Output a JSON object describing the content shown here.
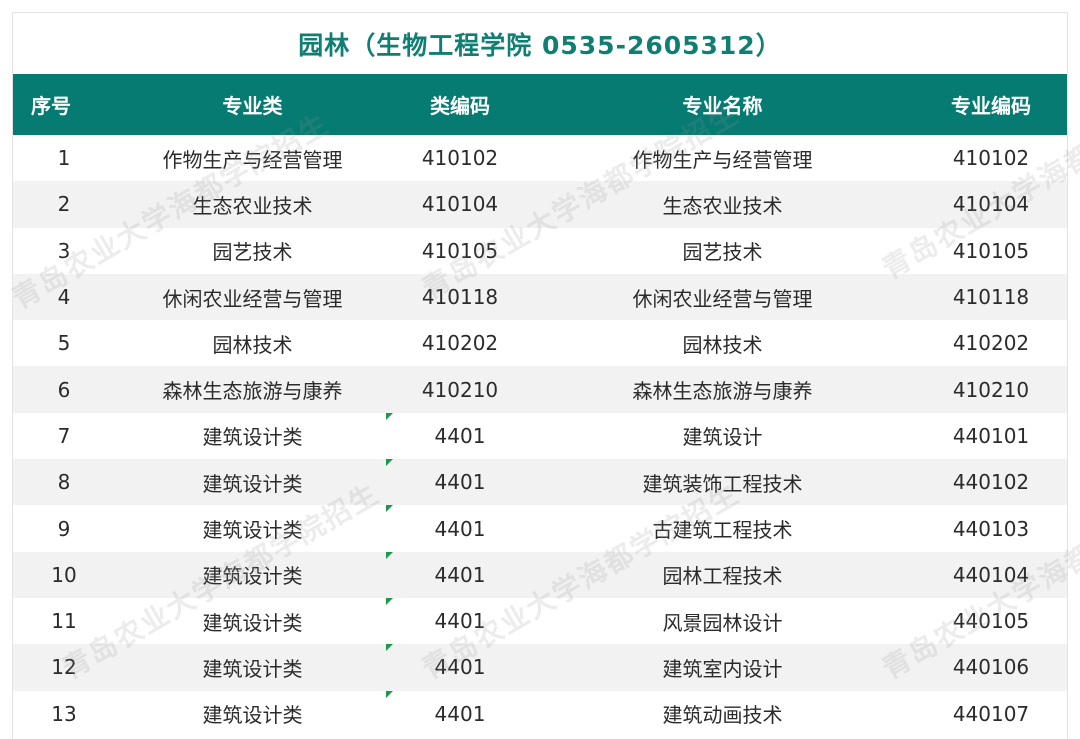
{
  "title": "园林（生物工程学院 0535-2605312）",
  "columns": [
    "序号",
    "专业类",
    "类编码",
    "专业名称",
    "专业编码"
  ],
  "rows": [
    {
      "idx": "1",
      "category": "作物生产与经营管理",
      "cat_code": "410102",
      "name": "作物生产与经营管理",
      "code": "410102",
      "flag": false
    },
    {
      "idx": "2",
      "category": "生态农业技术",
      "cat_code": "410104",
      "name": "生态农业技术",
      "code": "410104",
      "flag": false
    },
    {
      "idx": "3",
      "category": "园艺技术",
      "cat_code": "410105",
      "name": "园艺技术",
      "code": "410105",
      "flag": false
    },
    {
      "idx": "4",
      "category": "休闲农业经营与管理",
      "cat_code": "410118",
      "name": "休闲农业经营与管理",
      "code": "410118",
      "flag": false
    },
    {
      "idx": "5",
      "category": "园林技术",
      "cat_code": "410202",
      "name": "园林技术",
      "code": "410202",
      "flag": false
    },
    {
      "idx": "6",
      "category": "森林生态旅游与康养",
      "cat_code": "410210",
      "name": "森林生态旅游与康养",
      "code": "410210",
      "flag": false
    },
    {
      "idx": "7",
      "category": "建筑设计类",
      "cat_code": "4401",
      "name": "建筑设计",
      "code": "440101",
      "flag": true
    },
    {
      "idx": "8",
      "category": "建筑设计类",
      "cat_code": "4401",
      "name": "建筑装饰工程技术",
      "code": "440102",
      "flag": true
    },
    {
      "idx": "9",
      "category": "建筑设计类",
      "cat_code": "4401",
      "name": "古建筑工程技术",
      "code": "440103",
      "flag": true
    },
    {
      "idx": "10",
      "category": "建筑设计类",
      "cat_code": "4401",
      "name": "园林工程技术",
      "code": "440104",
      "flag": true
    },
    {
      "idx": "11",
      "category": "建筑设计类",
      "cat_code": "4401",
      "name": "风景园林设计",
      "code": "440105",
      "flag": true
    },
    {
      "idx": "12",
      "category": "建筑设计类",
      "cat_code": "4401",
      "name": "建筑室内设计",
      "code": "440106",
      "flag": true
    },
    {
      "idx": "13",
      "category": "建筑设计类",
      "cat_code": "4401",
      "name": "建筑动画技术",
      "code": "440107",
      "flag": true
    }
  ],
  "watermark": "青岛农业大学海都学院招生",
  "colors": {
    "accent": "#067b72",
    "title": "#0e7f72",
    "stripe": "#f2f2f2",
    "flag": "#1a9a4a"
  }
}
